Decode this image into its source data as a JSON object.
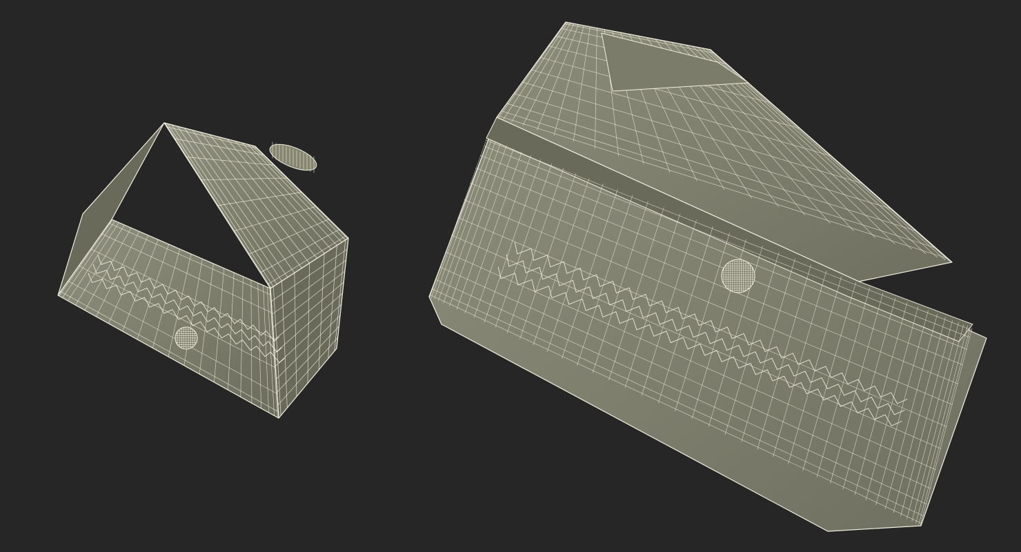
{
  "scene": {
    "background_color": "#262626",
    "mesh_fill_color": "#82826f",
    "mesh_shade_color": "#6a6a5a",
    "wire_color": "#f3f1e0",
    "objects": [
      {
        "name": "small-part",
        "render_mode": "wireframe-on-shaded"
      },
      {
        "name": "large-part",
        "render_mode": "wireframe-on-shaded"
      }
    ]
  }
}
